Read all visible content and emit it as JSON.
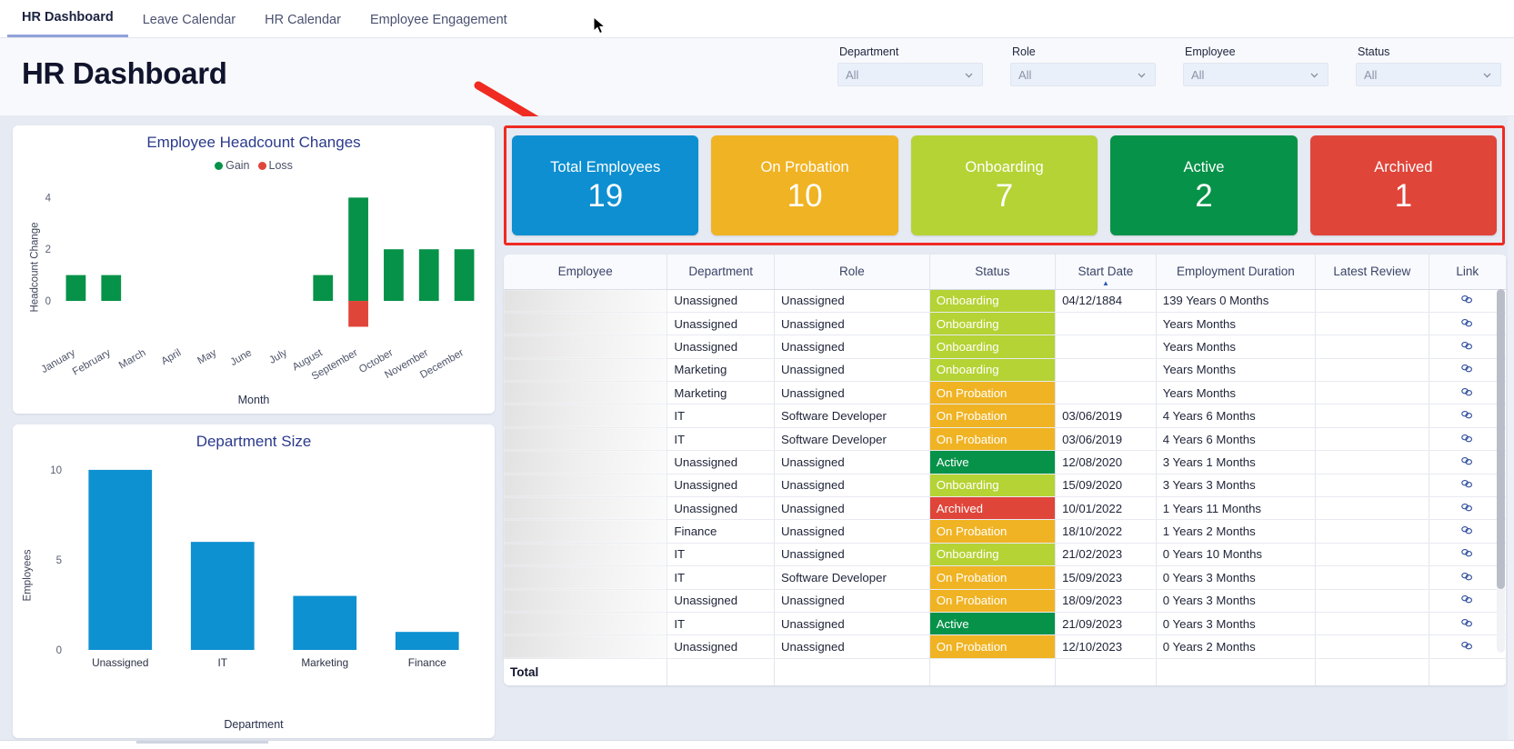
{
  "tabs": [
    {
      "label": "HR Dashboard",
      "active": true
    },
    {
      "label": "Leave Calendar",
      "active": false
    },
    {
      "label": "HR Calendar",
      "active": false
    },
    {
      "label": "Employee Engagement",
      "active": false
    }
  ],
  "header": {
    "title": "HR Dashboard"
  },
  "filters": [
    {
      "label": "Department",
      "value": "All"
    },
    {
      "label": "Role",
      "value": "All"
    },
    {
      "label": "Employee",
      "value": "All"
    },
    {
      "label": "Status",
      "value": "All"
    }
  ],
  "kpis": [
    {
      "label": "Total Employees",
      "value": "19",
      "color": "#0d8fd1"
    },
    {
      "label": "On Probation",
      "value": "10",
      "color": "#f0b323"
    },
    {
      "label": "Onboarding",
      "value": "7",
      "color": "#b5d334"
    },
    {
      "label": "Active",
      "value": "2",
      "color": "#069248"
    },
    {
      "label": "Archived",
      "value": "1",
      "color": "#e0453a"
    }
  ],
  "status_colors": {
    "Onboarding": "#b5d334",
    "On Probation": "#f0b323",
    "Active": "#069248",
    "Archived": "#e0453a"
  },
  "table": {
    "columns": [
      "Employee",
      "Department",
      "Role",
      "Status",
      "Start Date",
      "Employment Duration",
      "Latest Review",
      "Link"
    ],
    "sorted_column": "Start Date",
    "sort_direction": "asc",
    "link_icon": "link-icon",
    "total_label": "Total",
    "rows": [
      {
        "employee": "",
        "department": "Unassigned",
        "role": "Unassigned",
        "status": "Onboarding",
        "start_date": "04/12/1884",
        "duration": "139 Years 0 Months",
        "latest_review": "",
        "link": "ᶜᵒ"
      },
      {
        "employee": "",
        "department": "Unassigned",
        "role": "Unassigned",
        "status": "Onboarding",
        "start_date": "",
        "duration": "Years Months",
        "latest_review": "",
        "link": "ᶜᵒ"
      },
      {
        "employee": "",
        "department": "Unassigned",
        "role": "Unassigned",
        "status": "Onboarding",
        "start_date": "",
        "duration": "Years Months",
        "latest_review": "",
        "link": "ᶜᵒ"
      },
      {
        "employee": "",
        "department": "Marketing",
        "role": "Unassigned",
        "status": "Onboarding",
        "start_date": "",
        "duration": "Years Months",
        "latest_review": "",
        "link": "ᶜᵒ"
      },
      {
        "employee": "",
        "department": "Marketing",
        "role": "Unassigned",
        "status": "On Probation",
        "start_date": "",
        "duration": "Years Months",
        "latest_review": "",
        "link": "ᶜᵒ"
      },
      {
        "employee": "",
        "department": "IT",
        "role": "Software Developer",
        "status": "On Probation",
        "start_date": "03/06/2019",
        "duration": "4 Years 6 Months",
        "latest_review": "",
        "link": "ᶜᵒ"
      },
      {
        "employee": "",
        "department": "IT",
        "role": "Software Developer",
        "status": "On Probation",
        "start_date": "03/06/2019",
        "duration": "4 Years 6 Months",
        "latest_review": "",
        "link": "ᶜᵒ"
      },
      {
        "employee": "",
        "department": "Unassigned",
        "role": "Unassigned",
        "status": "Active",
        "start_date": "12/08/2020",
        "duration": "3 Years 1 Months",
        "latest_review": "",
        "link": "ᶜᵒ"
      },
      {
        "employee": "",
        "department": "Unassigned",
        "role": "Unassigned",
        "status": "Onboarding",
        "start_date": "15/09/2020",
        "duration": "3 Years 3 Months",
        "latest_review": "",
        "link": "ᶜᵒ"
      },
      {
        "employee": "",
        "department": "Unassigned",
        "role": "Unassigned",
        "status": "Archived",
        "start_date": "10/01/2022",
        "duration": "1 Years 11 Months",
        "latest_review": "",
        "link": "ᶜᵒ"
      },
      {
        "employee": "",
        "department": "Finance",
        "role": "Unassigned",
        "status": "On Probation",
        "start_date": "18/10/2022",
        "duration": "1 Years 2 Months",
        "latest_review": "",
        "link": "ᶜᵒ"
      },
      {
        "employee": "",
        "department": "IT",
        "role": "Unassigned",
        "status": "Onboarding",
        "start_date": "21/02/2023",
        "duration": "0 Years 10 Months",
        "latest_review": "",
        "link": "ᶜᵒ"
      },
      {
        "employee": "",
        "department": "IT",
        "role": "Software Developer",
        "status": "On Probation",
        "start_date": "15/09/2023",
        "duration": "0 Years 3 Months",
        "latest_review": "",
        "link": "ᶜᵒ"
      },
      {
        "employee": "",
        "department": "Unassigned",
        "role": "Unassigned",
        "status": "On Probation",
        "start_date": "18/09/2023",
        "duration": "0 Years 3 Months",
        "latest_review": "",
        "link": "ᶜᵒ"
      },
      {
        "employee": "",
        "department": "IT",
        "role": "Unassigned",
        "status": "Active",
        "start_date": "21/09/2023",
        "duration": "0 Years 3 Months",
        "latest_review": "",
        "link": "ᶜᵒ"
      },
      {
        "employee": "",
        "department": "Unassigned",
        "role": "Unassigned",
        "status": "On Probation",
        "start_date": "12/10/2023",
        "duration": "0 Years 2 Months",
        "latest_review": "",
        "link": "ᶜᵒ"
      }
    ]
  },
  "chart_data": [
    {
      "type": "bar",
      "title": "Employee Headcount Changes",
      "xlabel": "Month",
      "ylabel": "Headcount Change",
      "categories": [
        "January",
        "February",
        "March",
        "April",
        "May",
        "June",
        "July",
        "August",
        "September",
        "October",
        "November",
        "December"
      ],
      "series": [
        {
          "name": "Gain",
          "color": "#069248",
          "values": [
            1,
            1,
            0,
            0,
            0,
            0,
            0,
            1,
            4,
            2,
            2,
            2
          ]
        },
        {
          "name": "Loss",
          "color": "#e0453a",
          "values": [
            0,
            0,
            0,
            0,
            0,
            0,
            0,
            0,
            -1,
            0,
            0,
            0
          ]
        }
      ],
      "yticks": [
        0,
        2,
        4
      ],
      "ylim": [
        -1.3,
        4.4
      ],
      "legend_position": "top",
      "grid": false
    },
    {
      "type": "bar",
      "title": "Department Size",
      "xlabel": "Department",
      "ylabel": "Employees",
      "categories": [
        "Unassigned",
        "IT",
        "Marketing",
        "Finance"
      ],
      "values": [
        10,
        6,
        3,
        1
      ],
      "color": "#0d91d1",
      "yticks": [
        0,
        5,
        10
      ],
      "ylim": [
        0,
        10.5
      ],
      "grid": false
    }
  ]
}
